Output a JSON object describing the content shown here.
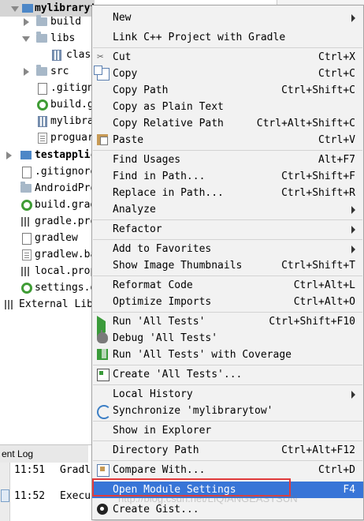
{
  "tree": {
    "rows": [
      {
        "label": "mylibrarytow",
        "bold": true
      },
      {
        "label": "build"
      },
      {
        "label": "libs"
      },
      {
        "label": "clas"
      },
      {
        "label": "src"
      },
      {
        "label": ".gitign"
      },
      {
        "label": "build.g"
      },
      {
        "label": "mylibra"
      },
      {
        "label": "proguar"
      },
      {
        "label": "testapplic",
        "bold": true
      },
      {
        "label": ".gitignore"
      },
      {
        "label": "AndroidPro"
      },
      {
        "label": "build.grad"
      },
      {
        "label": "gradle.pro"
      },
      {
        "label": "gradlew"
      },
      {
        "label": "gradlew.ba"
      },
      {
        "label": "local.prop"
      },
      {
        "label": "settings.g"
      },
      {
        "label": "External Lib"
      }
    ]
  },
  "event_log": {
    "title": "ent Log",
    "lines": [
      {
        "time": "11:51",
        "text": "Gradl"
      },
      {
        "time": "11:52",
        "text": "Execu"
      }
    ]
  },
  "menu": {
    "items": [
      {
        "label": "New",
        "shortcut": "",
        "submenu": true
      },
      {
        "label": "Link C++ Project with Gradle",
        "shortcut": ""
      },
      {
        "label": "Cut",
        "shortcut": "Ctrl+X",
        "icon": "scissors-icon"
      },
      {
        "label": "Copy",
        "shortcut": "Ctrl+C",
        "icon": "copy-icon"
      },
      {
        "label": "Copy Path",
        "shortcut": "Ctrl+Shift+C"
      },
      {
        "label": "Copy as Plain Text",
        "shortcut": ""
      },
      {
        "label": "Copy Relative Path",
        "shortcut": "Ctrl+Alt+Shift+C"
      },
      {
        "label": "Paste",
        "shortcut": "Ctrl+V",
        "icon": "paste-icon"
      },
      {
        "label": "Find Usages",
        "shortcut": "Alt+F7"
      },
      {
        "label": "Find in Path...",
        "shortcut": "Ctrl+Shift+F"
      },
      {
        "label": "Replace in Path...",
        "shortcut": "Ctrl+Shift+R"
      },
      {
        "label": "Analyze",
        "shortcut": "",
        "submenu": true
      },
      {
        "label": "Refactor",
        "shortcut": "",
        "submenu": true
      },
      {
        "label": "Add to Favorites",
        "shortcut": "",
        "submenu": true
      },
      {
        "label": "Show Image Thumbnails",
        "shortcut": "Ctrl+Shift+T"
      },
      {
        "label": "Reformat Code",
        "shortcut": "Ctrl+Alt+L"
      },
      {
        "label": "Optimize Imports",
        "shortcut": "Ctrl+Alt+O"
      },
      {
        "label": "Run 'All Tests'",
        "shortcut": "Ctrl+Shift+F10",
        "icon": "run-icon"
      },
      {
        "label": "Debug 'All Tests'",
        "shortcut": "",
        "icon": "debug-icon"
      },
      {
        "label": "Run 'All Tests' with Coverage",
        "shortcut": "",
        "icon": "coverage-icon"
      },
      {
        "label": "Create 'All Tests'...",
        "shortcut": "",
        "icon": "create-test-icon"
      },
      {
        "label": "Local History",
        "shortcut": "",
        "submenu": true
      },
      {
        "label": "Synchronize 'mylibrarytow'",
        "shortcut": "",
        "icon": "sync-icon"
      },
      {
        "label": "Show in Explorer",
        "shortcut": ""
      },
      {
        "label": "Directory Path",
        "shortcut": "Ctrl+Alt+F12"
      },
      {
        "label": "Compare With...",
        "shortcut": "Ctrl+D",
        "icon": "compare-icon"
      },
      {
        "label": "Open Module Settings",
        "shortcut": "F4",
        "selected": true
      },
      {
        "label": "Create Gist...",
        "shortcut": "",
        "icon": "github-icon"
      }
    ]
  },
  "watermark": "http://blog.csdn.net/LIQIANGEASTSUN",
  "colors": {
    "selection": "#3875d7",
    "highlight_box": "#e23b3b",
    "menu_bg": "#f2f2f2"
  }
}
